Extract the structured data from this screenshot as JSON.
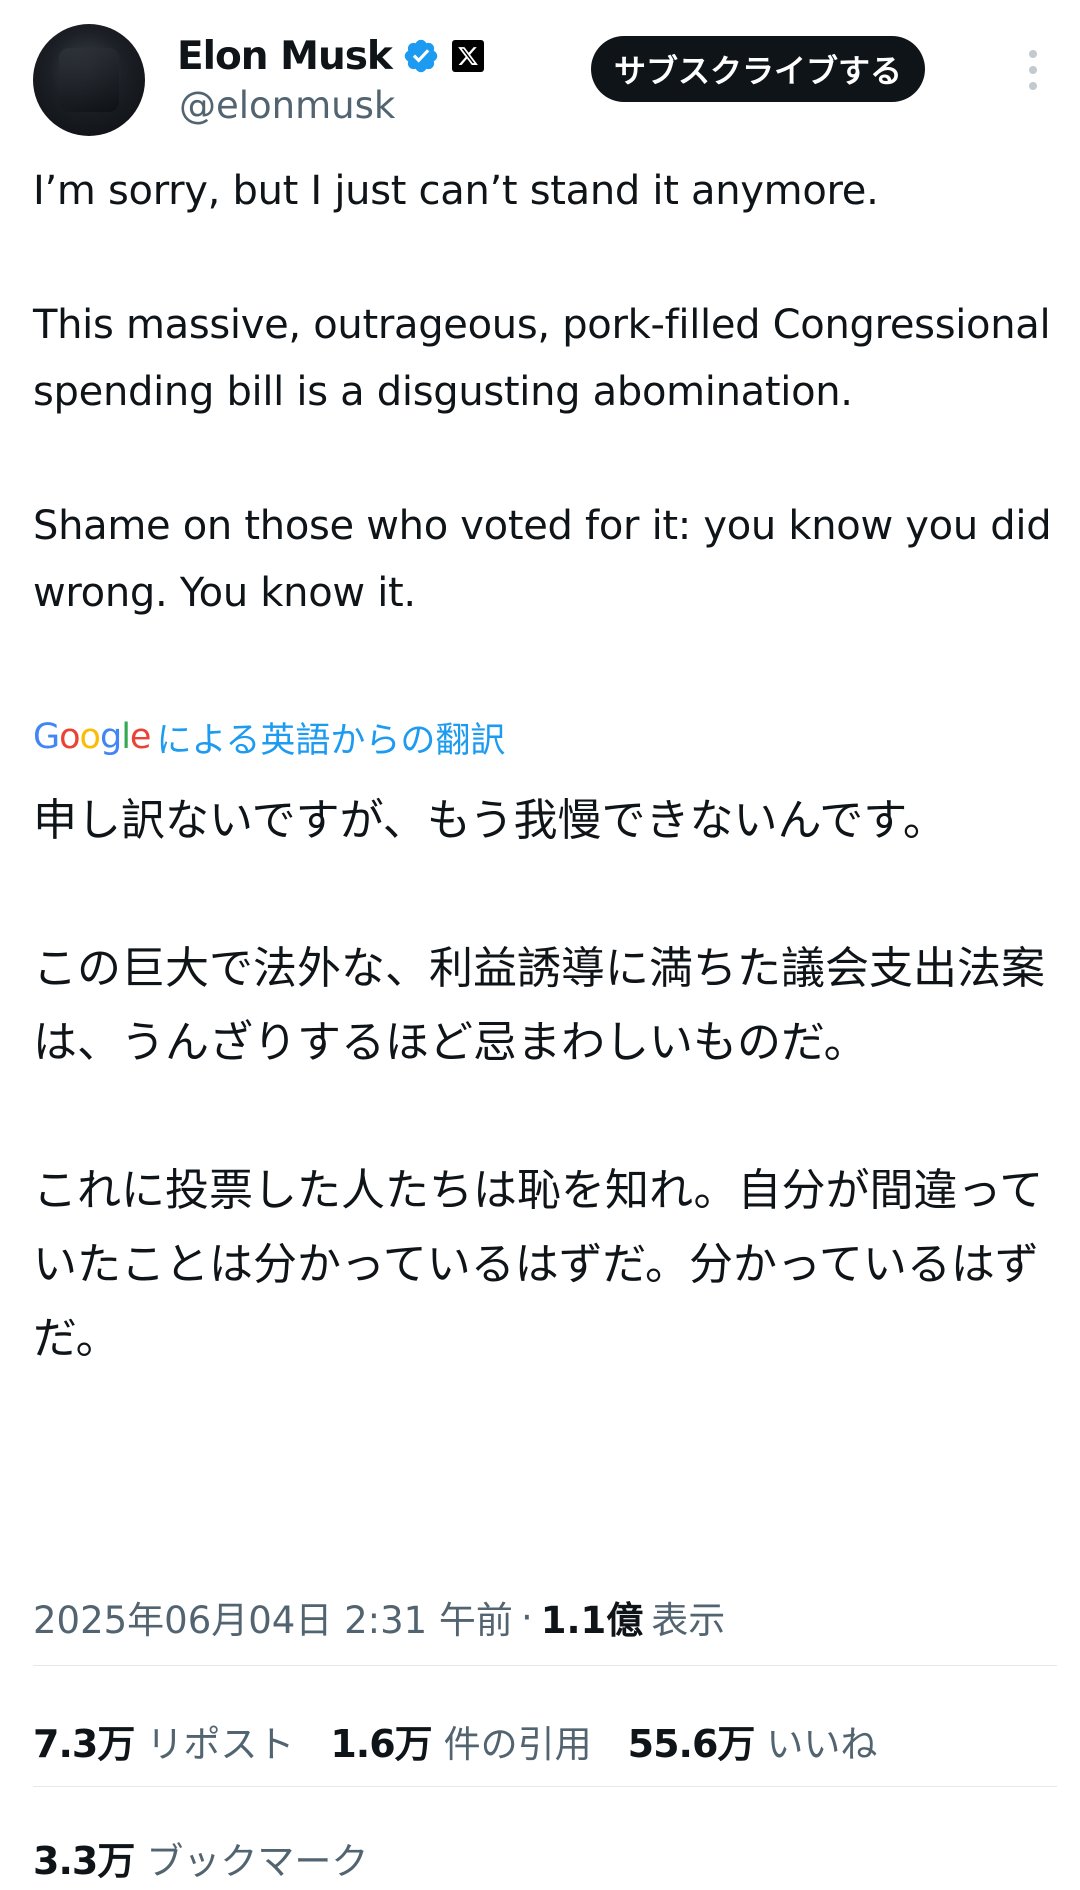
{
  "author": {
    "name": "Elon Musk",
    "handle": "@elonmusk",
    "verified_color": "#1d9bf0"
  },
  "header": {
    "subscribe_label": "サブスクライブする"
  },
  "tweet": {
    "text_en": "I’m sorry, but I just can’t stand it anymore.\n\nThis massive, outrageous, pork-filled Congressional spending bill is a disgusting abomination.\n\nShame on those who voted for it: you know you did wrong. You know it.",
    "translation_brand": "Google",
    "translation_label": "による英語からの翻訳",
    "text_ja": "申し訳ないですが、もう我慢できないんです。\n\nこの巨大で法外な、利益誘導に満ちた議会支出法案は、うんざりするほど忌まわしいものだ。\n\nこれに投票した人たちは恥を知れ。自分が間違っていたことは分かっているはずだ。分かっているはずだ。"
  },
  "meta": {
    "timestamp": "2025年06月04日 2:31 午前",
    "separator": "·",
    "views_count": "1.1億",
    "views_label": "表示"
  },
  "stats": {
    "reposts_count": "7.3万",
    "reposts_label": "リポスト",
    "quotes_count": "1.6万",
    "quotes_label": "件の引用",
    "likes_count": "55.6万",
    "likes_label": "いいね",
    "bookmarks_count": "3.3万",
    "bookmarks_label": "ブックマーク"
  },
  "icons": {
    "verified": "verified-badge-icon",
    "x_logo": "x-logo-icon",
    "more": "more-options-icon"
  },
  "colors": {
    "text": "#0f1419",
    "secondary": "#536471",
    "link": "#1d9bf0",
    "button_bg": "#0f1419"
  }
}
